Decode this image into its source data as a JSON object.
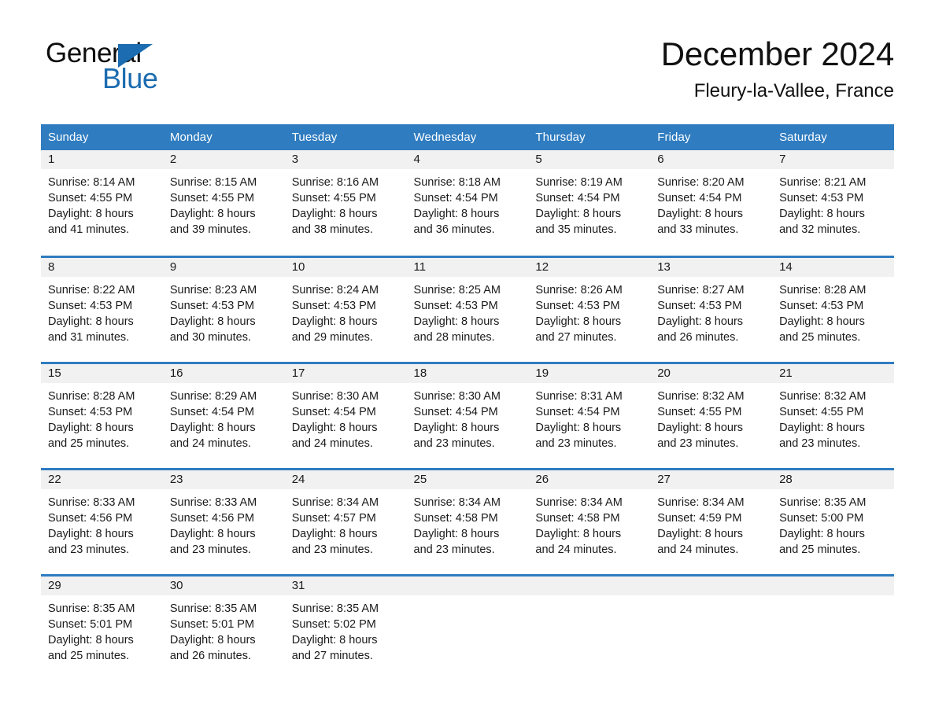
{
  "brand": {
    "name_part1": "General",
    "name_part2": "Blue",
    "accent_color": "#1b6cb0"
  },
  "header": {
    "title": "December 2024",
    "subtitle": "Fleury-la-Vallee, France"
  },
  "theme": {
    "header_row_color": "#2f7cc0",
    "date_strip_color": "#f1f1f1",
    "text_color": "#1a1a1a",
    "page_background": "#ffffff"
  },
  "weekday_headers": [
    "Sunday",
    "Monday",
    "Tuesday",
    "Wednesday",
    "Thursday",
    "Friday",
    "Saturday"
  ],
  "weeks": [
    {
      "days": [
        {
          "date": "1",
          "sunrise": "Sunrise: 8:14 AM",
          "sunset": "Sunset: 4:55 PM",
          "daylight_line1": "Daylight: 8 hours",
          "daylight_line2": "and 41 minutes."
        },
        {
          "date": "2",
          "sunrise": "Sunrise: 8:15 AM",
          "sunset": "Sunset: 4:55 PM",
          "daylight_line1": "Daylight: 8 hours",
          "daylight_line2": "and 39 minutes."
        },
        {
          "date": "3",
          "sunrise": "Sunrise: 8:16 AM",
          "sunset": "Sunset: 4:55 PM",
          "daylight_line1": "Daylight: 8 hours",
          "daylight_line2": "and 38 minutes."
        },
        {
          "date": "4",
          "sunrise": "Sunrise: 8:18 AM",
          "sunset": "Sunset: 4:54 PM",
          "daylight_line1": "Daylight: 8 hours",
          "daylight_line2": "and 36 minutes."
        },
        {
          "date": "5",
          "sunrise": "Sunrise: 8:19 AM",
          "sunset": "Sunset: 4:54 PM",
          "daylight_line1": "Daylight: 8 hours",
          "daylight_line2": "and 35 minutes."
        },
        {
          "date": "6",
          "sunrise": "Sunrise: 8:20 AM",
          "sunset": "Sunset: 4:54 PM",
          "daylight_line1": "Daylight: 8 hours",
          "daylight_line2": "and 33 minutes."
        },
        {
          "date": "7",
          "sunrise": "Sunrise: 8:21 AM",
          "sunset": "Sunset: 4:53 PM",
          "daylight_line1": "Daylight: 8 hours",
          "daylight_line2": "and 32 minutes."
        }
      ]
    },
    {
      "days": [
        {
          "date": "8",
          "sunrise": "Sunrise: 8:22 AM",
          "sunset": "Sunset: 4:53 PM",
          "daylight_line1": "Daylight: 8 hours",
          "daylight_line2": "and 31 minutes."
        },
        {
          "date": "9",
          "sunrise": "Sunrise: 8:23 AM",
          "sunset": "Sunset: 4:53 PM",
          "daylight_line1": "Daylight: 8 hours",
          "daylight_line2": "and 30 minutes."
        },
        {
          "date": "10",
          "sunrise": "Sunrise: 8:24 AM",
          "sunset": "Sunset: 4:53 PM",
          "daylight_line1": "Daylight: 8 hours",
          "daylight_line2": "and 29 minutes."
        },
        {
          "date": "11",
          "sunrise": "Sunrise: 8:25 AM",
          "sunset": "Sunset: 4:53 PM",
          "daylight_line1": "Daylight: 8 hours",
          "daylight_line2": "and 28 minutes."
        },
        {
          "date": "12",
          "sunrise": "Sunrise: 8:26 AM",
          "sunset": "Sunset: 4:53 PM",
          "daylight_line1": "Daylight: 8 hours",
          "daylight_line2": "and 27 minutes."
        },
        {
          "date": "13",
          "sunrise": "Sunrise: 8:27 AM",
          "sunset": "Sunset: 4:53 PM",
          "daylight_line1": "Daylight: 8 hours",
          "daylight_line2": "and 26 minutes."
        },
        {
          "date": "14",
          "sunrise": "Sunrise: 8:28 AM",
          "sunset": "Sunset: 4:53 PM",
          "daylight_line1": "Daylight: 8 hours",
          "daylight_line2": "and 25 minutes."
        }
      ]
    },
    {
      "days": [
        {
          "date": "15",
          "sunrise": "Sunrise: 8:28 AM",
          "sunset": "Sunset: 4:53 PM",
          "daylight_line1": "Daylight: 8 hours",
          "daylight_line2": "and 25 minutes."
        },
        {
          "date": "16",
          "sunrise": "Sunrise: 8:29 AM",
          "sunset": "Sunset: 4:54 PM",
          "daylight_line1": "Daylight: 8 hours",
          "daylight_line2": "and 24 minutes."
        },
        {
          "date": "17",
          "sunrise": "Sunrise: 8:30 AM",
          "sunset": "Sunset: 4:54 PM",
          "daylight_line1": "Daylight: 8 hours",
          "daylight_line2": "and 24 minutes."
        },
        {
          "date": "18",
          "sunrise": "Sunrise: 8:30 AM",
          "sunset": "Sunset: 4:54 PM",
          "daylight_line1": "Daylight: 8 hours",
          "daylight_line2": "and 23 minutes."
        },
        {
          "date": "19",
          "sunrise": "Sunrise: 8:31 AM",
          "sunset": "Sunset: 4:54 PM",
          "daylight_line1": "Daylight: 8 hours",
          "daylight_line2": "and 23 minutes."
        },
        {
          "date": "20",
          "sunrise": "Sunrise: 8:32 AM",
          "sunset": "Sunset: 4:55 PM",
          "daylight_line1": "Daylight: 8 hours",
          "daylight_line2": "and 23 minutes."
        },
        {
          "date": "21",
          "sunrise": "Sunrise: 8:32 AM",
          "sunset": "Sunset: 4:55 PM",
          "daylight_line1": "Daylight: 8 hours",
          "daylight_line2": "and 23 minutes."
        }
      ]
    },
    {
      "days": [
        {
          "date": "22",
          "sunrise": "Sunrise: 8:33 AM",
          "sunset": "Sunset: 4:56 PM",
          "daylight_line1": "Daylight: 8 hours",
          "daylight_line2": "and 23 minutes."
        },
        {
          "date": "23",
          "sunrise": "Sunrise: 8:33 AM",
          "sunset": "Sunset: 4:56 PM",
          "daylight_line1": "Daylight: 8 hours",
          "daylight_line2": "and 23 minutes."
        },
        {
          "date": "24",
          "sunrise": "Sunrise: 8:34 AM",
          "sunset": "Sunset: 4:57 PM",
          "daylight_line1": "Daylight: 8 hours",
          "daylight_line2": "and 23 minutes."
        },
        {
          "date": "25",
          "sunrise": "Sunrise: 8:34 AM",
          "sunset": "Sunset: 4:58 PM",
          "daylight_line1": "Daylight: 8 hours",
          "daylight_line2": "and 23 minutes."
        },
        {
          "date": "26",
          "sunrise": "Sunrise: 8:34 AM",
          "sunset": "Sunset: 4:58 PM",
          "daylight_line1": "Daylight: 8 hours",
          "daylight_line2": "and 24 minutes."
        },
        {
          "date": "27",
          "sunrise": "Sunrise: 8:34 AM",
          "sunset": "Sunset: 4:59 PM",
          "daylight_line1": "Daylight: 8 hours",
          "daylight_line2": "and 24 minutes."
        },
        {
          "date": "28",
          "sunrise": "Sunrise: 8:35 AM",
          "sunset": "Sunset: 5:00 PM",
          "daylight_line1": "Daylight: 8 hours",
          "daylight_line2": "and 25 minutes."
        }
      ]
    },
    {
      "days": [
        {
          "date": "29",
          "sunrise": "Sunrise: 8:35 AM",
          "sunset": "Sunset: 5:01 PM",
          "daylight_line1": "Daylight: 8 hours",
          "daylight_line2": "and 25 minutes."
        },
        {
          "date": "30",
          "sunrise": "Sunrise: 8:35 AM",
          "sunset": "Sunset: 5:01 PM",
          "daylight_line1": "Daylight: 8 hours",
          "daylight_line2": "and 26 minutes."
        },
        {
          "date": "31",
          "sunrise": "Sunrise: 8:35 AM",
          "sunset": "Sunset: 5:02 PM",
          "daylight_line1": "Daylight: 8 hours",
          "daylight_line2": "and 27 minutes."
        },
        {
          "date": "",
          "sunrise": "",
          "sunset": "",
          "daylight_line1": "",
          "daylight_line2": ""
        },
        {
          "date": "",
          "sunrise": "",
          "sunset": "",
          "daylight_line1": "",
          "daylight_line2": ""
        },
        {
          "date": "",
          "sunrise": "",
          "sunset": "",
          "daylight_line1": "",
          "daylight_line2": ""
        },
        {
          "date": "",
          "sunrise": "",
          "sunset": "",
          "daylight_line1": "",
          "daylight_line2": ""
        }
      ]
    }
  ]
}
